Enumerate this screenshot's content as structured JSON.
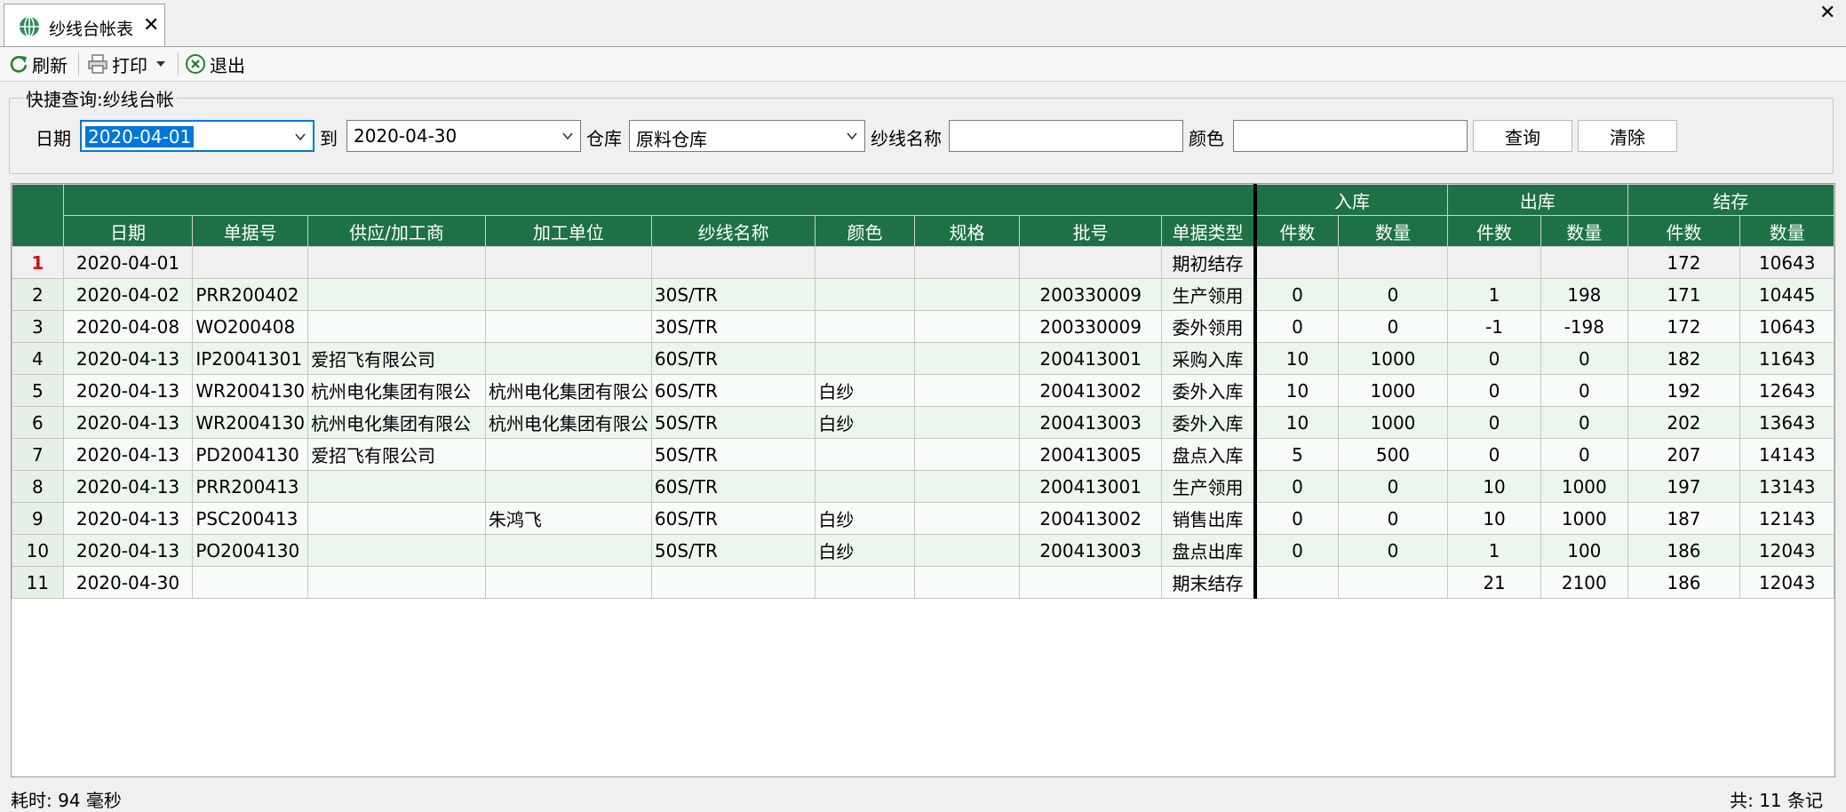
{
  "tab": {
    "title": "纱线台帐表",
    "icon": "globe-icon"
  },
  "toolbar": {
    "refresh": "刷新",
    "print": "打印",
    "exit": "退出"
  },
  "query": {
    "legend": "快捷查询:纱线台帐",
    "date_label": "日期",
    "date_from": "2020-04-01",
    "to_label": "到",
    "date_to": "2020-04-30",
    "warehouse_label": "仓库",
    "warehouse": "原料仓库",
    "yarn_label": "纱线名称",
    "yarn_value": "",
    "color_label": "颜色",
    "color_value": "",
    "search_button": "查询",
    "clear_button": "清除"
  },
  "grid": {
    "group_headers": {
      "in": "入库",
      "out": "出库",
      "balance": "结存"
    },
    "columns": [
      "日期",
      "单据号",
      "供应/加工商",
      "加工单位",
      "纱线名称",
      "颜色",
      "规格",
      "批号",
      "单据类型",
      "件数",
      "数量",
      "件数",
      "数量",
      "件数",
      "数量"
    ],
    "rows": [
      [
        "1",
        "2020-04-01",
        "",
        "",
        "",
        "",
        "",
        "",
        "",
        "期初结存",
        "",
        "",
        "",
        "",
        "172",
        "10643"
      ],
      [
        "2",
        "2020-04-02",
        "PRR200402",
        "",
        "",
        "30S/TR",
        "",
        "",
        "200330009",
        "生产领用",
        "0",
        "0",
        "1",
        "198",
        "171",
        "10445"
      ],
      [
        "3",
        "2020-04-08",
        "WO200408",
        "",
        "",
        "30S/TR",
        "",
        "",
        "200330009",
        "委外领用",
        "0",
        "0",
        "-1",
        "-198",
        "172",
        "10643"
      ],
      [
        "4",
        "2020-04-13",
        "IP20041301",
        "爱招飞有限公司",
        "",
        "60S/TR",
        "",
        "",
        "200413001",
        "采购入库",
        "10",
        "1000",
        "0",
        "0",
        "182",
        "11643"
      ],
      [
        "5",
        "2020-04-13",
        "WR2004130",
        "杭州电化集团有限公",
        "杭州电化集团有限公",
        "60S/TR",
        "白纱",
        "",
        "200413002",
        "委外入库",
        "10",
        "1000",
        "0",
        "0",
        "192",
        "12643"
      ],
      [
        "6",
        "2020-04-13",
        "WR2004130",
        "杭州电化集团有限公",
        "杭州电化集团有限公",
        "50S/TR",
        "白纱",
        "",
        "200413003",
        "委外入库",
        "10",
        "1000",
        "0",
        "0",
        "202",
        "13643"
      ],
      [
        "7",
        "2020-04-13",
        "PD2004130",
        "爱招飞有限公司",
        "",
        "50S/TR",
        "",
        "",
        "200413005",
        "盘点入库",
        "5",
        "500",
        "0",
        "0",
        "207",
        "14143"
      ],
      [
        "8",
        "2020-04-13",
        "PRR200413",
        "",
        "",
        "60S/TR",
        "",
        "",
        "200413001",
        "生产领用",
        "0",
        "0",
        "10",
        "1000",
        "197",
        "13143"
      ],
      [
        "9",
        "2020-04-13",
        "PSC200413",
        "",
        "朱鸿飞",
        "60S/TR",
        "白纱",
        "",
        "200413002",
        "销售出库",
        "0",
        "0",
        "10",
        "1000",
        "187",
        "12143"
      ],
      [
        "10",
        "2020-04-13",
        "PO2004130",
        "",
        "",
        "50S/TR",
        "白纱",
        "",
        "200413003",
        "盘点出库",
        "0",
        "0",
        "1",
        "100",
        "186",
        "12043"
      ],
      [
        "11",
        "2020-04-30",
        "",
        "",
        "",
        "",
        "",
        "",
        "",
        "期末结存",
        "",
        "",
        "21",
        "2100",
        "186",
        "12043"
      ]
    ]
  },
  "status": {
    "elapsed": "耗时: 94 毫秒",
    "count": "共: 11 条记"
  },
  "colors": {
    "header_bg": "#1e7145",
    "row_odd": "#ecf6ec",
    "row_even": "#f8fcf8",
    "selection": "#0078d7",
    "first_row_number": "#d01010"
  }
}
